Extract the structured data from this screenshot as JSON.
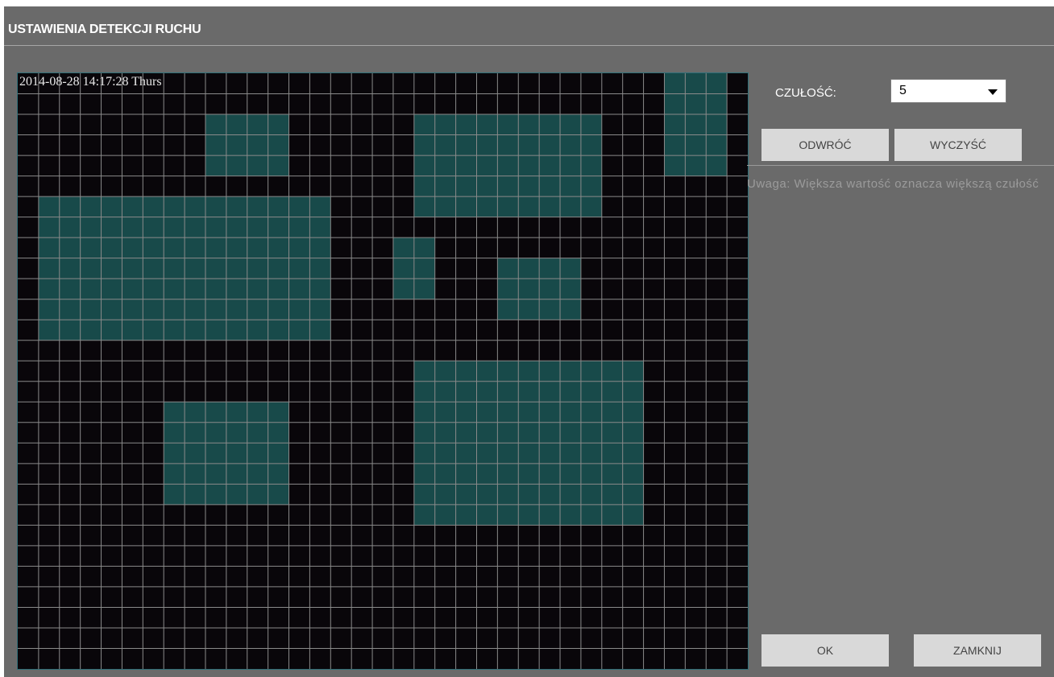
{
  "dialog": {
    "title": "USTAWIENIA DETEKCJI RUCHU"
  },
  "video": {
    "timestamp": "2014-08-28 14:17:28 Thurs",
    "grid_columns": 35,
    "grid_rows": 29,
    "grid_line_color": "#8a8a8a",
    "active_cell_color": "#184a4a",
    "background_color": "#09060a",
    "active_regions": [
      {
        "col": 31,
        "row": 0,
        "cols": 3,
        "rows": 5
      },
      {
        "col": 9,
        "row": 2,
        "cols": 4,
        "rows": 3
      },
      {
        "col": 19,
        "row": 2,
        "cols": 9,
        "rows": 5
      },
      {
        "col": 1,
        "row": 6,
        "cols": 14,
        "rows": 7
      },
      {
        "col": 18,
        "row": 8,
        "cols": 2,
        "rows": 3
      },
      {
        "col": 23,
        "row": 9,
        "cols": 4,
        "rows": 3
      },
      {
        "col": 19,
        "row": 14,
        "cols": 11,
        "rows": 8
      },
      {
        "col": 7,
        "row": 16,
        "cols": 6,
        "rows": 5
      }
    ]
  },
  "sensitivity": {
    "label": "CZUŁOŚĆ:",
    "value": "5"
  },
  "buttons": {
    "invert": "ODWRÓĆ",
    "clear": "WYCZYŚĆ",
    "ok": "OK",
    "close": "ZAMKNIJ"
  },
  "note": "Uwaga: Większa wartość oznacza większą czułość",
  "colors": {
    "panel": "#6a6a6a",
    "button": "#d9d9d9",
    "note_text": "#9b9b9b"
  }
}
